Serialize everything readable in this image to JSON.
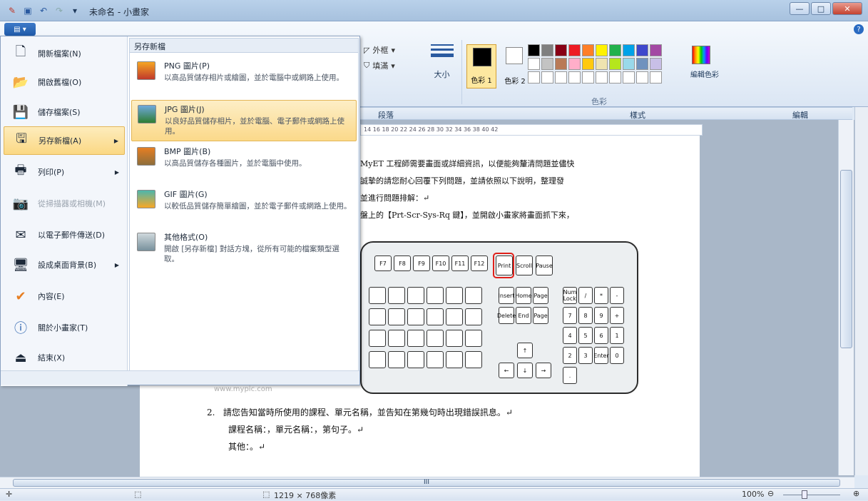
{
  "window": {
    "title": "未命名 - 小畫家"
  },
  "ribbon": {
    "outline_label": "外框",
    "fill_label": "填滿",
    "size_label": "大小",
    "color1_label": "色彩 1",
    "color2_label": "色彩 2",
    "edit_colors_label": "編輯色彩",
    "colors_group_label": "色彩",
    "panel_labels": [
      "段落",
      "樣式",
      "編輯"
    ],
    "palette": [
      "#000000",
      "#7f7f7f",
      "#880015",
      "#ed1c24",
      "#ff7f27",
      "#fff200",
      "#22b14c",
      "#00a2e8",
      "#3f48cc",
      "#a349a4",
      "#ffffff",
      "#c3c3c3",
      "#b97a57",
      "#ffaec9",
      "#ffc90e",
      "#efe4b0",
      "#b5e61d",
      "#99d9ea",
      "#7092be",
      "#c8bfe7",
      "#ffffff",
      "#ffffff",
      "#ffffff",
      "#ffffff",
      "#ffffff",
      "#ffffff",
      "#ffffff",
      "#ffffff",
      "#ffffff",
      "#ffffff"
    ]
  },
  "ruler_text": "14  16  18  20  22  24  26  28  30  32  34  36  38  40  42",
  "document": {
    "lines": [
      "MyET 工程師需要畫面或詳細資訊，以便能夠釐清問題並儘快",
      "誠摯的請您耐心回覆下列問題，並請依照以下說明，整理發",
      "並進行問題排解：↵",
      "盤上的【Prt-Scr-Sys-Rq 鍵】，並開啟小畫家將畫面抓下來，"
    ],
    "q2_number": "2.",
    "q2_text": "請您告知當時所使用的課程、單元名稱，並告知在第幾句時出現錯誤訊息。↵",
    "q2_line2": "課程名稱：，單元名稱：，第句子。↵",
    "q2_line3": "其他：。↵",
    "watermark": "www.mypic.com"
  },
  "keyboard": {
    "top_keys": [
      "F7",
      "F8",
      "F9",
      "F10",
      "F11",
      "F12"
    ],
    "sys_keys": [
      "Print Screen SysRq",
      "Scroll Lock",
      "Pause Break"
    ],
    "nav_keys": [
      "Insert",
      "Home",
      "Page Up",
      "Delete",
      "End",
      "Page Down"
    ],
    "num_keys": [
      "Num Lock",
      "/",
      "*",
      "-",
      "7",
      "8",
      "9",
      "+",
      "4",
      "5",
      "6",
      "1",
      "2",
      "3",
      "Enter",
      "0",
      "."
    ]
  },
  "menu": {
    "left_items": [
      {
        "label": "開新檔案(N)",
        "icon": "new-file-icon"
      },
      {
        "label": "開啟舊檔(O)",
        "icon": "open-folder-icon"
      },
      {
        "label": "儲存檔案(S)",
        "icon": "save-disk-icon"
      },
      {
        "label": "另存新檔(A)",
        "icon": "save-as-icon",
        "selected": true,
        "has_submenu": true
      },
      {
        "label": "列印(P)",
        "icon": "printer-icon",
        "has_submenu": true
      },
      {
        "label": "從掃描器或相機(M)",
        "icon": "scanner-icon",
        "disabled": true
      },
      {
        "label": "以電子郵件傳送(D)",
        "icon": "email-icon"
      },
      {
        "label": "設成桌面背景(B)",
        "icon": "desktop-icon",
        "has_submenu": true
      },
      {
        "label": "內容(E)",
        "icon": "checkmark-icon"
      },
      {
        "label": "關於小畫家(T)",
        "icon": "info-icon"
      },
      {
        "label": "結束(X)",
        "icon": "exit-icon"
      }
    ],
    "submenu_title": "另存新檔",
    "submenu_items": [
      {
        "label": "PNG 圖片(P)",
        "desc": "以高品質儲存相片或繪圖，並於電腦中或網路上使用。",
        "icon": "png-icon"
      },
      {
        "label": "JPG 圖片(J)",
        "desc": "以良好品質儲存相片，並於電腦、電子郵件或網路上使用。",
        "icon": "jpg-icon",
        "selected": true
      },
      {
        "label": "BMP 圖片(B)",
        "desc": "以高品質儲存各種圖片，並於電腦中使用。",
        "icon": "bmp-icon"
      },
      {
        "label": "GIF 圖片(G)",
        "desc": "以較低品質儲存簡單繪圖，並於電子郵件或網路上使用。",
        "icon": "gif-icon"
      },
      {
        "label": "其他格式(O)",
        "desc": "開啟 [另存新檔] 對話方塊，從所有可能的檔案類型選取。",
        "icon": "other-format-icon"
      }
    ]
  },
  "statusbar": {
    "dimensions": "1219 × 768像素",
    "zoom": "100%"
  }
}
